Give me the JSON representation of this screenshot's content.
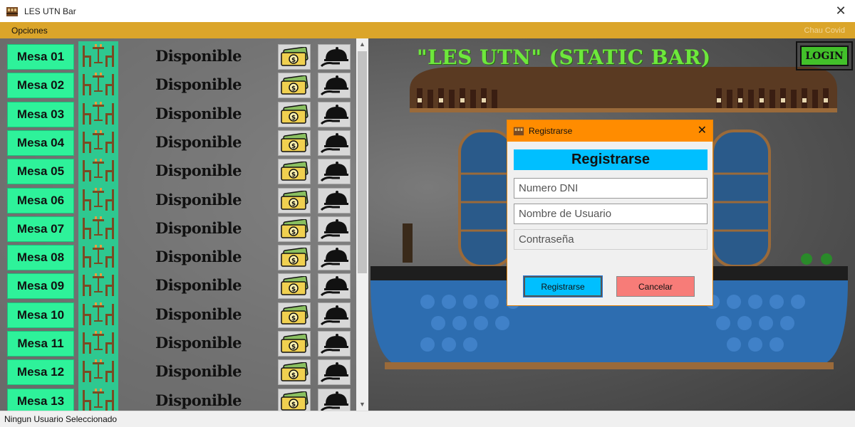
{
  "window": {
    "title": "LES UTN Bar",
    "close_glyph": "✕"
  },
  "menubar": {
    "opciones": "Opciones",
    "status_right": "Chau Covid"
  },
  "heading": "\"LES UTN\" (STATIC BAR)",
  "login": {
    "label": "LOGIN"
  },
  "tables": [
    {
      "label": "Mesa 01",
      "status": "Disponible"
    },
    {
      "label": "Mesa 02",
      "status": "Disponible"
    },
    {
      "label": "Mesa 03",
      "status": "Disponible"
    },
    {
      "label": "Mesa 04",
      "status": "Disponible"
    },
    {
      "label": "Mesa 05",
      "status": "Disponible"
    },
    {
      "label": "Mesa 06",
      "status": "Disponible"
    },
    {
      "label": "Mesa 07",
      "status": "Disponible"
    },
    {
      "label": "Mesa 08",
      "status": "Disponible"
    },
    {
      "label": "Mesa 09",
      "status": "Disponible"
    },
    {
      "label": "Mesa 10",
      "status": "Disponible"
    },
    {
      "label": "Mesa 11",
      "status": "Disponible"
    },
    {
      "label": "Mesa 12",
      "status": "Disponible"
    },
    {
      "label": "Mesa 13",
      "status": "Disponible"
    }
  ],
  "icons": {
    "table": "table-chairs-icon",
    "pay": "money-bill-icon",
    "serve": "serving-cloche-icon"
  },
  "dialog": {
    "title": "Registrarse",
    "header": "Registrarse",
    "fields": {
      "dni_placeholder": "Numero DNI",
      "usuario_placeholder": "Nombre de Usuario",
      "contrasena_placeholder": "Contraseña"
    },
    "buttons": {
      "registrar": "Registrarse",
      "cancelar": "Cancelar"
    },
    "close_glyph": "✕"
  },
  "statusbar": {
    "text": "Ningun Usuario Seleccionado"
  },
  "colors": {
    "menubar": "#dba52a",
    "mesa_button": "#2ef29a",
    "dialog_title": "#ff8c00",
    "dialog_header": "#00bfff",
    "cancel_button": "#f77c78",
    "login_button": "#42c02a",
    "heading": "#6ee83c"
  }
}
